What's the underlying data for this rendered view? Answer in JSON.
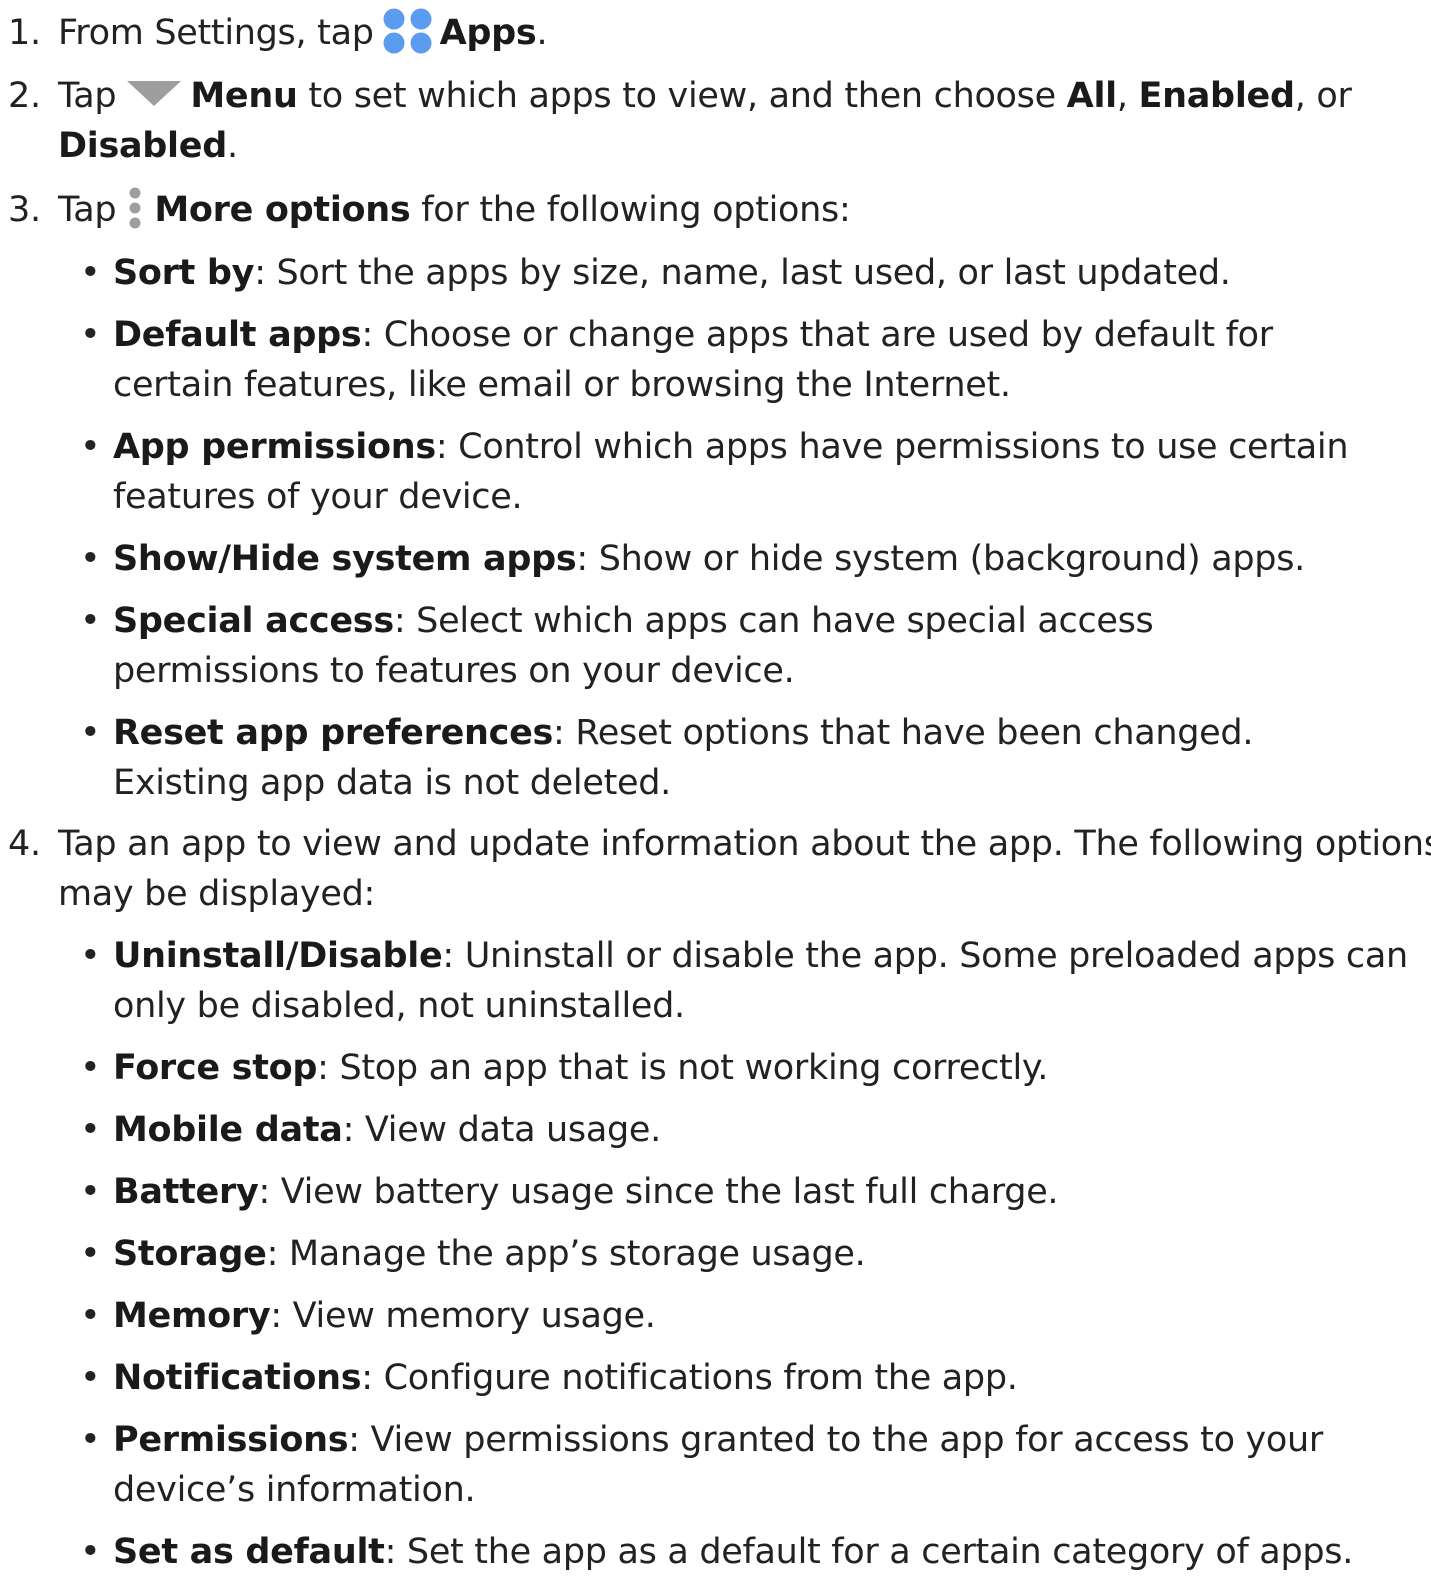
{
  "steps": [
    {
      "num": "1.",
      "pre": "From Settings, tap",
      "bold": "Apps",
      "post": "."
    },
    {
      "num": "2.",
      "pre": "Tap",
      "bold1": "Menu",
      "mid1": " to set which apps to view, and then choose ",
      "bold2": "All",
      "mid2": ", ",
      "bold3": "Enabled",
      "mid3": ", or ",
      "bold4": "Disabled",
      "post": "."
    },
    {
      "num": "3.",
      "pre": "Tap",
      "bold": "More options",
      "post": " for the following options:",
      "bullets": [
        {
          "term": "Sort by",
          "desc": ": Sort the apps by size, name, last used, or last updated."
        },
        {
          "term": "Default apps",
          "desc": ": Choose or change apps that are used by default for certain features, like email or browsing the Internet."
        },
        {
          "term": "App permissions",
          "desc": ": Control which apps have permissions to use certain features of your device."
        },
        {
          "term": "Show/Hide system apps",
          "desc": ": Show or hide system (background) apps."
        },
        {
          "term": "Special access",
          "desc": ": Select which apps can have special access permissions to features on your device."
        },
        {
          "term": "Reset app preferences",
          "desc": ": Reset options that have been changed. Existing app data is not deleted."
        }
      ]
    },
    {
      "num": "4.",
      "text": "Tap an app to view and update information about the app. The following options may be displayed:",
      "bullets": [
        {
          "term": "Uninstall/Disable",
          "desc": ": Uninstall or disable the app. Some preloaded apps can only be disabled, not uninstalled."
        },
        {
          "term": "Force stop",
          "desc": ": Stop an app that is not working correctly."
        },
        {
          "term": "Mobile data",
          "desc": ": View data usage."
        },
        {
          "term": "Battery",
          "desc": ": View battery usage since the last full charge."
        },
        {
          "term": "Storage",
          "desc": ": Manage the app’s storage usage."
        },
        {
          "term": "Memory",
          "desc": ": View memory usage."
        },
        {
          "term": "Notifications",
          "desc": ": Configure notifications from the app."
        },
        {
          "term": "Permissions",
          "desc": ": View permissions granted to the app for access to your device’s information."
        },
        {
          "term": "Set as default",
          "desc": ": Set the app as a default for a certain category of apps."
        }
      ]
    }
  ],
  "bullet_glyph": "•",
  "icons": {
    "apps": "apps-grid-icon",
    "menu": "triangle-down-icon",
    "more": "vertical-dots-icon"
  },
  "colors": {
    "apps_icon": "#5b9cf0",
    "menu_icon": "#9e9e9e",
    "more_icon": "#9e9e9e",
    "text": "#222222"
  }
}
